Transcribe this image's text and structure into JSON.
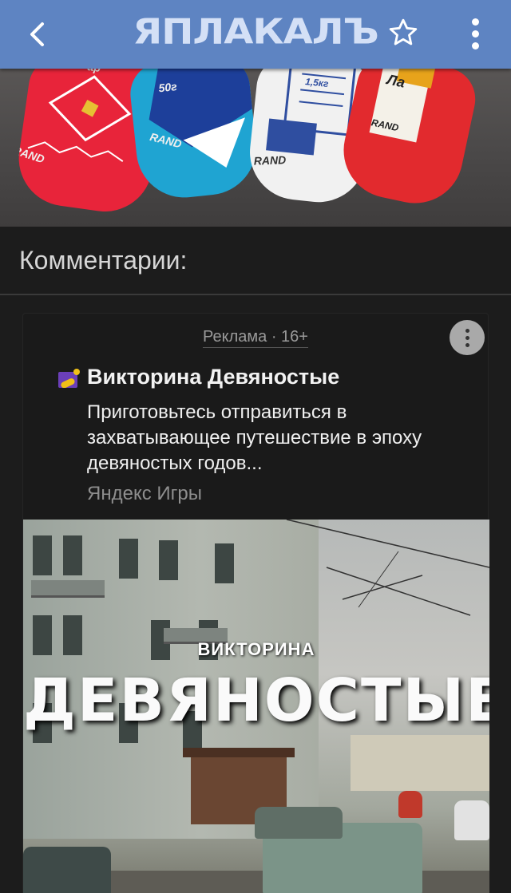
{
  "header": {
    "logo": "ЯПЛАКАЛЪ",
    "back_icon": "chevron-left-icon",
    "favorite_icon": "star-outline-icon",
    "menu_icon": "more-vertical-icon",
    "bar_color": "#5e84c2"
  },
  "hero": {
    "socks": [
      "ap",
      "RAND",
      "50г",
      "RAND",
      "1,5кг",
      "RAND",
      "Ла",
      "RAND"
    ]
  },
  "comments": {
    "title": "Комментарии:"
  },
  "ad": {
    "label": "Реклама · 16+",
    "title": "Викторина Девяностые",
    "text": "Приготовьтесь отправиться в захватывающее путешествие в эпоху девяностых годов...",
    "source": "Яндекс Игры",
    "image": {
      "caption_small": "ВИКТОРИНА",
      "caption_big": "ДЕВЯНОСТЫЕ"
    }
  }
}
